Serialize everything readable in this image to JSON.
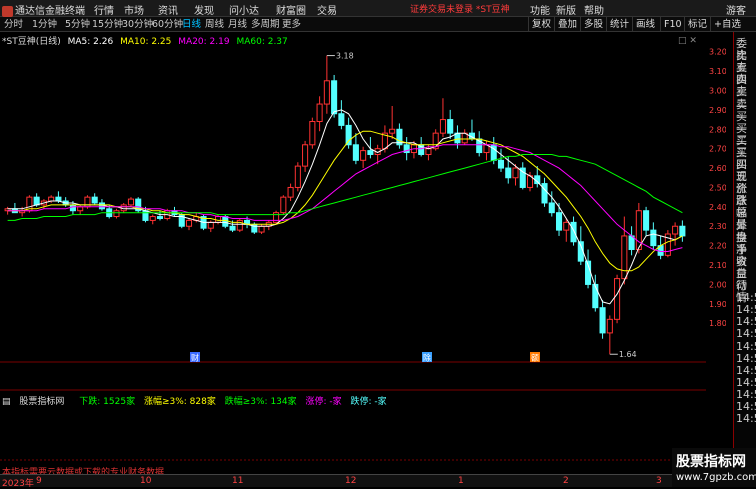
{
  "app": {
    "title": "通达信金融终端",
    "user": "游客",
    "notice": "证券交易未登录 *ST豆神"
  },
  "menu": [
    "行情",
    "市场",
    "资讯",
    "发现",
    "问小达",
    "财富圈",
    "交易"
  ],
  "menu_right": [
    "功能",
    "新版",
    "帮助"
  ],
  "periods": [
    "分时",
    "1分钟",
    "5分钟",
    "15分钟",
    "30分钟",
    "60分钟",
    "日线",
    "周线",
    "月线",
    "多周期",
    "更多"
  ],
  "active_period": "日线",
  "right_tools": [
    "复权",
    "叠加",
    "多股",
    "统计",
    "画线",
    "F10",
    "标记",
    "+自选"
  ],
  "legend": {
    "stock": "*ST豆神(日线)",
    "ma5": "MA5: 2.26",
    "ma10": "MA10: 2.25",
    "ma20": "MA20: 2.19",
    "ma60": "MA60: 2.37"
  },
  "colors": {
    "up": "#ff3232",
    "down": "#54ffff",
    "ma5": "#ffffff",
    "ma10": "#ffff00",
    "ma20": "#ff00ff",
    "ma60": "#00ff00",
    "grid": "#7a0000"
  },
  "price_axis": [
    "3.20",
    "3.10",
    "3.00",
    "2.90",
    "2.80",
    "2.70",
    "2.60",
    "2.50",
    "2.40",
    "2.30",
    "2.20",
    "2.10",
    "2.00",
    "1.90",
    "1.80"
  ],
  "annotations": {
    "high": "3.18",
    "low": "1.64"
  },
  "event_markers": [
    "财",
    "除",
    "额"
  ],
  "quotes_labels": [
    "委比",
    "卖五",
    "卖四",
    "卖三",
    "卖二",
    "卖一",
    "买一",
    "买二",
    "买三",
    "买四",
    "买五",
    "现价",
    "涨跌",
    "涨幅",
    "总量",
    "外盘",
    "换手",
    "净资",
    "收益",
    "自动",
    "行情",
    "14:54",
    "14:54",
    "14:54",
    "14:55",
    "14:55",
    "14:55",
    "14:55",
    "14:55",
    "14:55",
    "14:55",
    "14:55"
  ],
  "sub_legend": {
    "name": "股票指标网",
    "down": "下跌: 1525家",
    "up3": "涨幅≥3%: 828家",
    "down3": "跌幅≥3%: 134家",
    "limit_up": "涨停: -家",
    "limit_down": "跌停: -家"
  },
  "footer_note": "本指标需要云数据或下载的专业财务数据",
  "dates": [
    "2023年",
    "9",
    "10",
    "11",
    "12",
    "1",
    "2",
    "3"
  ],
  "watermark": {
    "line1": "股票指标网",
    "line2": "www.7gpzb.com"
  },
  "chart_data": {
    "type": "candlestick",
    "ylim": [
      1.6,
      3.25
    ],
    "candles": [
      [
        2.38,
        2.4,
        2.36,
        2.39
      ],
      [
        2.39,
        2.42,
        2.37,
        2.37
      ],
      [
        2.37,
        2.4,
        2.35,
        2.38
      ],
      [
        2.38,
        2.46,
        2.37,
        2.45
      ],
      [
        2.45,
        2.47,
        2.4,
        2.41
      ],
      [
        2.41,
        2.44,
        2.39,
        2.43
      ],
      [
        2.43,
        2.46,
        2.42,
        2.45
      ],
      [
        2.45,
        2.48,
        2.42,
        2.43
      ],
      [
        2.43,
        2.45,
        2.4,
        2.41
      ],
      [
        2.41,
        2.43,
        2.36,
        2.38
      ],
      [
        2.38,
        2.41,
        2.36,
        2.4
      ],
      [
        2.4,
        2.46,
        2.39,
        2.45
      ],
      [
        2.45,
        2.47,
        2.41,
        2.42
      ],
      [
        2.42,
        2.44,
        2.38,
        2.39
      ],
      [
        2.39,
        2.41,
        2.34,
        2.35
      ],
      [
        2.35,
        2.39,
        2.34,
        2.38
      ],
      [
        2.38,
        2.42,
        2.37,
        2.41
      ],
      [
        2.41,
        2.45,
        2.4,
        2.44
      ],
      [
        2.44,
        2.45,
        2.37,
        2.38
      ],
      [
        2.38,
        2.4,
        2.32,
        2.33
      ],
      [
        2.33,
        2.36,
        2.31,
        2.35
      ],
      [
        2.35,
        2.38,
        2.33,
        2.34
      ],
      [
        2.34,
        2.39,
        2.33,
        2.38
      ],
      [
        2.38,
        2.4,
        2.35,
        2.36
      ],
      [
        2.36,
        2.37,
        2.29,
        2.3
      ],
      [
        2.3,
        2.34,
        2.28,
        2.33
      ],
      [
        2.33,
        2.37,
        2.32,
        2.35
      ],
      [
        2.35,
        2.36,
        2.28,
        2.29
      ],
      [
        2.29,
        2.33,
        2.27,
        2.32
      ],
      [
        2.32,
        2.36,
        2.31,
        2.35
      ],
      [
        2.35,
        2.36,
        2.29,
        2.3
      ],
      [
        2.3,
        2.33,
        2.27,
        2.28
      ],
      [
        2.28,
        2.34,
        2.27,
        2.33
      ],
      [
        2.33,
        2.35,
        2.29,
        2.31
      ],
      [
        2.31,
        2.32,
        2.26,
        2.27
      ],
      [
        2.27,
        2.31,
        2.26,
        2.3
      ],
      [
        2.3,
        2.33,
        2.28,
        2.32
      ],
      [
        2.32,
        2.38,
        2.31,
        2.37
      ],
      [
        2.37,
        2.46,
        2.36,
        2.45
      ],
      [
        2.45,
        2.52,
        2.43,
        2.5
      ],
      [
        2.5,
        2.63,
        2.48,
        2.61
      ],
      [
        2.61,
        2.74,
        2.58,
        2.72
      ],
      [
        2.72,
        2.86,
        2.7,
        2.84
      ],
      [
        2.84,
        2.97,
        2.79,
        2.93
      ],
      [
        2.93,
        3.18,
        2.88,
        3.05
      ],
      [
        3.05,
        3.08,
        2.86,
        2.88
      ],
      [
        2.88,
        2.95,
        2.8,
        2.82
      ],
      [
        2.82,
        2.86,
        2.7,
        2.72
      ],
      [
        2.72,
        2.78,
        2.62,
        2.64
      ],
      [
        2.64,
        2.71,
        2.6,
        2.69
      ],
      [
        2.69,
        2.76,
        2.65,
        2.67
      ],
      [
        2.67,
        2.72,
        2.62,
        2.7
      ],
      [
        2.7,
        2.82,
        2.68,
        2.78
      ],
      [
        2.78,
        2.92,
        2.75,
        2.8
      ],
      [
        2.8,
        2.83,
        2.7,
        2.72
      ],
      [
        2.72,
        2.76,
        2.64,
        2.68
      ],
      [
        2.68,
        2.74,
        2.65,
        2.72
      ],
      [
        2.72,
        2.76,
        2.66,
        2.67
      ],
      [
        2.67,
        2.72,
        2.64,
        2.7
      ],
      [
        2.7,
        2.8,
        2.69,
        2.78
      ],
      [
        2.78,
        2.96,
        2.76,
        2.85
      ],
      [
        2.85,
        2.9,
        2.75,
        2.78
      ],
      [
        2.78,
        2.82,
        2.7,
        2.73
      ],
      [
        2.73,
        2.8,
        2.72,
        2.78
      ],
      [
        2.78,
        2.85,
        2.74,
        2.75
      ],
      [
        2.75,
        2.79,
        2.66,
        2.68
      ],
      [
        2.68,
        2.74,
        2.64,
        2.72
      ],
      [
        2.72,
        2.76,
        2.62,
        2.64
      ],
      [
        2.64,
        2.7,
        2.58,
        2.6
      ],
      [
        2.6,
        2.66,
        2.52,
        2.55
      ],
      [
        2.55,
        2.62,
        2.51,
        2.6
      ],
      [
        2.6,
        2.63,
        2.49,
        2.5
      ],
      [
        2.5,
        2.58,
        2.48,
        2.56
      ],
      [
        2.56,
        2.61,
        2.5,
        2.52
      ],
      [
        2.52,
        2.55,
        2.4,
        2.42
      ],
      [
        2.42,
        2.48,
        2.35,
        2.37
      ],
      [
        2.37,
        2.42,
        2.25,
        2.28
      ],
      [
        2.28,
        2.34,
        2.22,
        2.32
      ],
      [
        2.32,
        2.35,
        2.2,
        2.22
      ],
      [
        2.22,
        2.3,
        2.1,
        2.12
      ],
      [
        2.12,
        2.18,
        1.98,
        2.0
      ],
      [
        2.0,
        2.05,
        1.86,
        1.88
      ],
      [
        1.88,
        1.92,
        1.72,
        1.75
      ],
      [
        1.75,
        1.84,
        1.64,
        1.82
      ],
      [
        1.82,
        2.05,
        1.8,
        2.03
      ],
      [
        2.03,
        2.35,
        2.0,
        2.25
      ],
      [
        2.25,
        2.3,
        2.15,
        2.18
      ],
      [
        2.18,
        2.42,
        2.16,
        2.38
      ],
      [
        2.38,
        2.4,
        2.25,
        2.28
      ],
      [
        2.28,
        2.32,
        2.18,
        2.2
      ],
      [
        2.2,
        2.25,
        2.13,
        2.15
      ],
      [
        2.15,
        2.28,
        2.14,
        2.26
      ],
      [
        2.26,
        2.32,
        2.2,
        2.3
      ],
      [
        2.3,
        2.33,
        2.22,
        2.25
      ]
    ],
    "ma5": [
      2.39,
      2.39,
      2.39,
      2.4,
      2.41,
      2.42,
      2.43,
      2.43,
      2.42,
      2.42,
      2.41,
      2.41,
      2.41,
      2.41,
      2.4,
      2.4,
      2.39,
      2.39,
      2.39,
      2.38,
      2.37,
      2.36,
      2.36,
      2.35,
      2.35,
      2.34,
      2.33,
      2.32,
      2.32,
      2.32,
      2.32,
      2.31,
      2.31,
      2.31,
      2.3,
      2.3,
      2.3,
      2.31,
      2.34,
      2.38,
      2.45,
      2.53,
      2.62,
      2.72,
      2.83,
      2.89,
      2.9,
      2.88,
      2.82,
      2.75,
      2.7,
      2.68,
      2.7,
      2.73,
      2.73,
      2.73,
      2.73,
      2.71,
      2.7,
      2.71,
      2.75,
      2.76,
      2.78,
      2.78,
      2.76,
      2.74,
      2.72,
      2.7,
      2.67,
      2.64,
      2.61,
      2.58,
      2.56,
      2.53,
      2.49,
      2.45,
      2.4,
      2.34,
      2.28,
      2.2,
      2.1,
      1.99,
      1.91,
      1.9,
      1.95,
      2.02,
      2.1,
      2.19,
      2.25,
      2.26,
      2.25,
      2.24,
      2.23,
      2.25
    ],
    "ma10": [
      2.38,
      2.38,
      2.38,
      2.39,
      2.39,
      2.4,
      2.41,
      2.41,
      2.41,
      2.41,
      2.41,
      2.41,
      2.41,
      2.41,
      2.41,
      2.4,
      2.4,
      2.4,
      2.39,
      2.39,
      2.38,
      2.38,
      2.37,
      2.37,
      2.36,
      2.36,
      2.35,
      2.34,
      2.34,
      2.33,
      2.33,
      2.32,
      2.32,
      2.31,
      2.31,
      2.31,
      2.31,
      2.31,
      2.32,
      2.34,
      2.37,
      2.41,
      2.46,
      2.52,
      2.58,
      2.64,
      2.69,
      2.74,
      2.77,
      2.79,
      2.79,
      2.78,
      2.77,
      2.76,
      2.74,
      2.73,
      2.72,
      2.72,
      2.72,
      2.72,
      2.73,
      2.74,
      2.75,
      2.75,
      2.75,
      2.75,
      2.74,
      2.73,
      2.72,
      2.7,
      2.68,
      2.66,
      2.63,
      2.6,
      2.57,
      2.53,
      2.49,
      2.45,
      2.4,
      2.35,
      2.29,
      2.22,
      2.16,
      2.11,
      2.08,
      2.07,
      2.07,
      2.09,
      2.13,
      2.17,
      2.2,
      2.22,
      2.23,
      2.25
    ],
    "ma20": [
      2.38,
      2.38,
      2.38,
      2.38,
      2.38,
      2.39,
      2.39,
      2.39,
      2.39,
      2.4,
      2.4,
      2.4,
      2.4,
      2.4,
      2.4,
      2.4,
      2.4,
      2.4,
      2.4,
      2.39,
      2.39,
      2.39,
      2.38,
      2.38,
      2.38,
      2.37,
      2.37,
      2.36,
      2.36,
      2.35,
      2.35,
      2.34,
      2.34,
      2.34,
      2.33,
      2.33,
      2.33,
      2.33,
      2.33,
      2.34,
      2.35,
      2.37,
      2.39,
      2.42,
      2.45,
      2.48,
      2.51,
      2.54,
      2.57,
      2.59,
      2.61,
      2.63,
      2.65,
      2.67,
      2.68,
      2.69,
      2.7,
      2.7,
      2.71,
      2.71,
      2.72,
      2.72,
      2.72,
      2.72,
      2.72,
      2.72,
      2.72,
      2.72,
      2.71,
      2.71,
      2.7,
      2.69,
      2.68,
      2.66,
      2.64,
      2.62,
      2.6,
      2.57,
      2.54,
      2.51,
      2.47,
      2.43,
      2.39,
      2.35,
      2.31,
      2.28,
      2.25,
      2.22,
      2.2,
      2.18,
      2.17,
      2.17,
      2.18,
      2.19
    ],
    "ma60": [
      2.33,
      2.33,
      2.34,
      2.34,
      2.34,
      2.35,
      2.35,
      2.35,
      2.35,
      2.36,
      2.36,
      2.36,
      2.36,
      2.37,
      2.37,
      2.37,
      2.37,
      2.37,
      2.37,
      2.37,
      2.37,
      2.37,
      2.37,
      2.37,
      2.37,
      2.37,
      2.37,
      2.37,
      2.37,
      2.36,
      2.36,
      2.36,
      2.36,
      2.36,
      2.36,
      2.36,
      2.36,
      2.36,
      2.36,
      2.37,
      2.37,
      2.38,
      2.39,
      2.4,
      2.41,
      2.42,
      2.43,
      2.44,
      2.45,
      2.46,
      2.47,
      2.48,
      2.49,
      2.5,
      2.51,
      2.52,
      2.53,
      2.54,
      2.55,
      2.56,
      2.57,
      2.58,
      2.59,
      2.6,
      2.61,
      2.62,
      2.63,
      2.64,
      2.65,
      2.66,
      2.66,
      2.67,
      2.67,
      2.67,
      2.67,
      2.67,
      2.66,
      2.66,
      2.65,
      2.64,
      2.63,
      2.62,
      2.6,
      2.58,
      2.56,
      2.54,
      2.52,
      2.5,
      2.48,
      2.45,
      2.43,
      2.41,
      2.39,
      2.37
    ]
  }
}
